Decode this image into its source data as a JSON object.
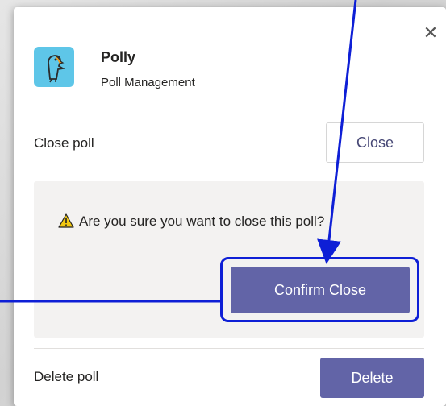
{
  "dialog": {
    "close_icon": "close-icon",
    "app": {
      "icon": "parrot-icon",
      "name": "Polly",
      "subtitle": "Poll Management"
    },
    "close_poll": {
      "label": "Close poll",
      "button": "Close"
    },
    "confirm": {
      "icon": "warning-icon",
      "message": "Are you sure you want to close this poll?",
      "button": "Confirm Close"
    },
    "delete_poll": {
      "label": "Delete poll",
      "button": "Delete"
    }
  },
  "colors": {
    "accent": "#6264a7",
    "annotation": "#0e1fd6",
    "app_icon_bg": "#5ec6e8",
    "confirm_bg": "#f3f2f1"
  }
}
